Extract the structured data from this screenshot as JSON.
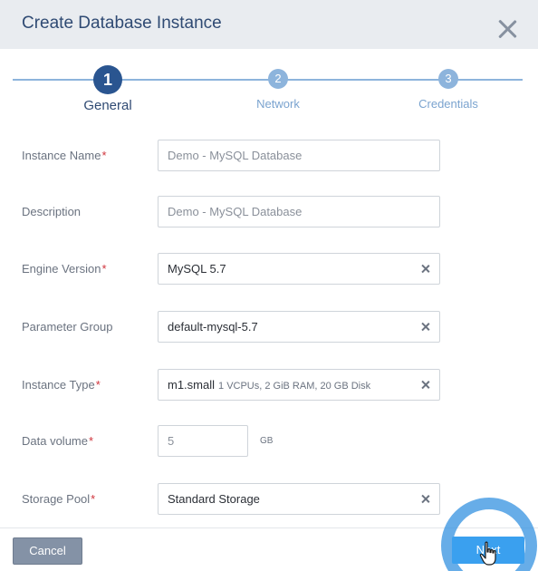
{
  "dialog": {
    "title": "Create Database Instance",
    "close_icon": "close-icon"
  },
  "stepper": {
    "steps": [
      {
        "number": "1",
        "label": "General",
        "active": true
      },
      {
        "number": "2",
        "label": "Network",
        "active": false
      },
      {
        "number": "3",
        "label": "Credentials",
        "active": false
      }
    ]
  },
  "form": {
    "instance_name": {
      "label": "Instance Name",
      "required": "*",
      "placeholder": "Demo - MySQL Database"
    },
    "description": {
      "label": "Description",
      "placeholder": "Demo - MySQL Database"
    },
    "engine_version": {
      "label": "Engine Version",
      "required": "*",
      "value": "MySQL 5.7"
    },
    "parameter_group": {
      "label": "Parameter Group",
      "value": "default-mysql-5.7"
    },
    "instance_type": {
      "label": "Instance Type",
      "required": "*",
      "value": "m1.small",
      "detail": "1 VCPUs, 2 GiB RAM, 20 GB Disk"
    },
    "data_volume": {
      "label": "Data volume",
      "required": "*",
      "value": "5",
      "unit": "GB"
    },
    "storage_pool": {
      "label": "Storage Pool",
      "required": "*",
      "value": "Standard Storage"
    }
  },
  "footer": {
    "cancel_label": "Cancel",
    "next_label": "Next"
  },
  "colors": {
    "primary": "#2a5590",
    "step_inactive": "#8db4dc",
    "required": "#d0343c",
    "next_button": "#3aa0ef",
    "cancel_button": "#8492a6"
  }
}
